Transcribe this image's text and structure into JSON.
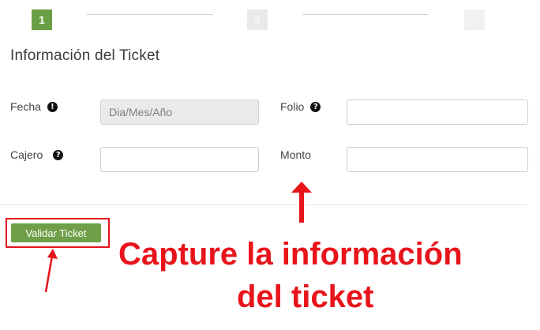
{
  "stepper": {
    "steps": [
      {
        "number": "1",
        "state": "active"
      },
      {
        "number": "2",
        "state": "inactive"
      },
      {
        "number": "",
        "state": "inactive"
      }
    ]
  },
  "form": {
    "title": "Información del Ticket",
    "fields": {
      "fecha": {
        "label": "Fecha",
        "info_icon": "!",
        "placeholder": "Dia/Mes/Año",
        "value": ""
      },
      "folio": {
        "label": "Folio",
        "info_icon": "?",
        "value": ""
      },
      "cajero": {
        "label": "Cajero",
        "info_icon": "?",
        "value": ""
      },
      "monto": {
        "label": "Monto",
        "value": ""
      }
    },
    "submit_label": "Validar Ticket"
  },
  "annotation": {
    "line1": "Capture la información",
    "line2": "del ticket",
    "color": "#e8141b"
  },
  "colors": {
    "accent_green": "#6f9f48",
    "annotation_red": "#e8141b"
  }
}
